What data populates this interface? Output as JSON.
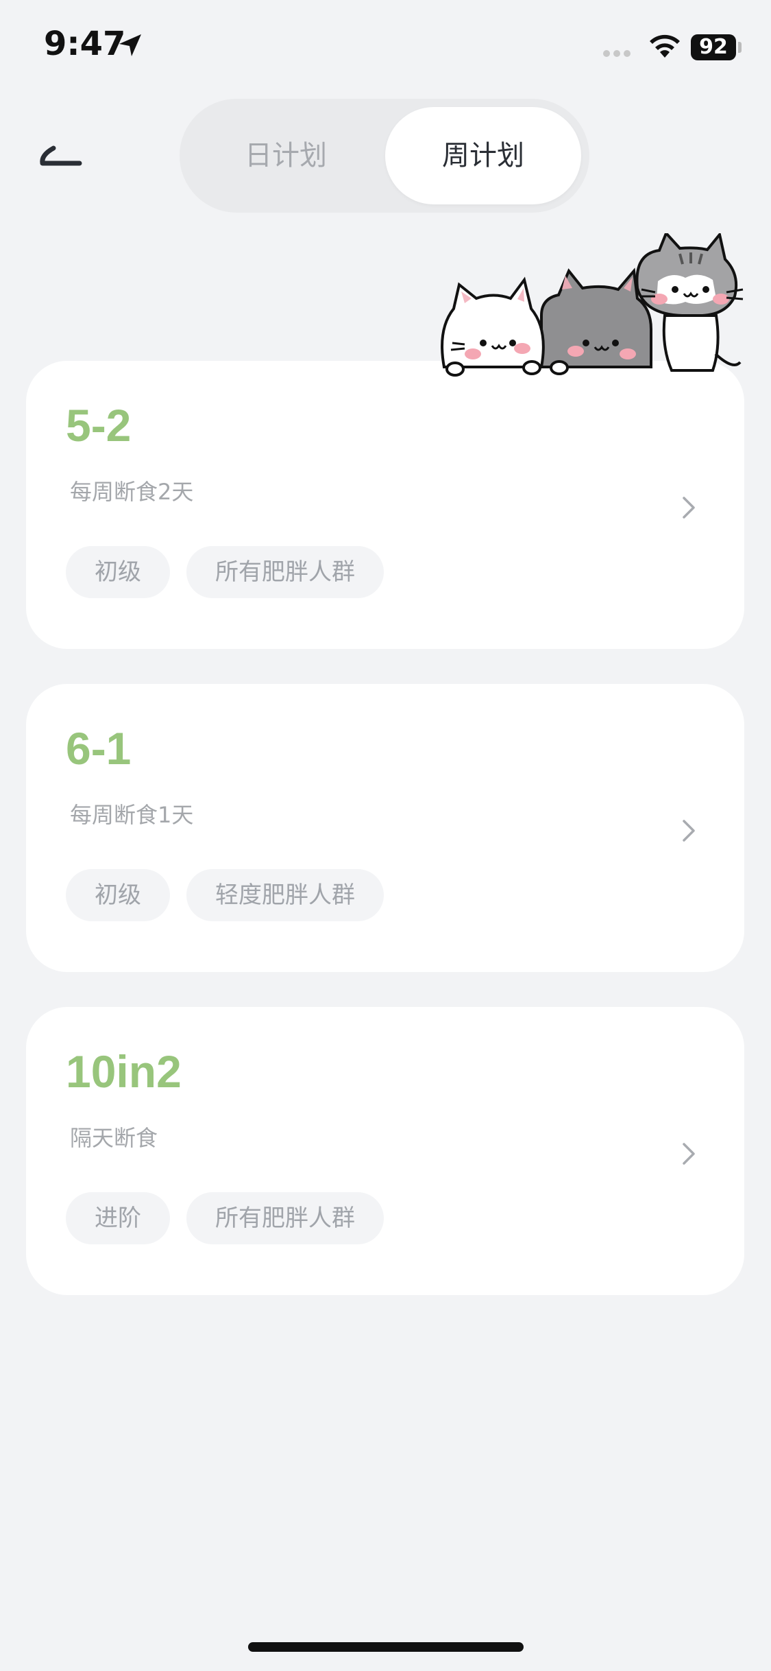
{
  "status_bar": {
    "time": "9:47",
    "battery": "92",
    "location_icon": "location-arrow-icon",
    "wifi_icon": "wifi-icon"
  },
  "header": {
    "back_icon": "back-icon",
    "tabs": [
      {
        "label": "日计划",
        "selected": false
      },
      {
        "label": "周计划",
        "selected": true
      }
    ]
  },
  "decoration": "cats-illustration",
  "plans": [
    {
      "title": "5-2",
      "description": "每周断食2天",
      "tags": [
        "初级",
        "所有肥胖人群"
      ]
    },
    {
      "title": "6-1",
      "description": "每周断食1天",
      "tags": [
        "初级",
        "轻度肥胖人群"
      ]
    },
    {
      "title": "10in2",
      "description": "隔天断食",
      "tags": [
        "进阶",
        "所有肥胖人群"
      ]
    }
  ],
  "colors": {
    "accent": "#98c57c",
    "background": "#f2f3f5",
    "card": "#ffffff",
    "tag_bg": "#f3f4f6",
    "muted_text": "#a4a7ab"
  }
}
